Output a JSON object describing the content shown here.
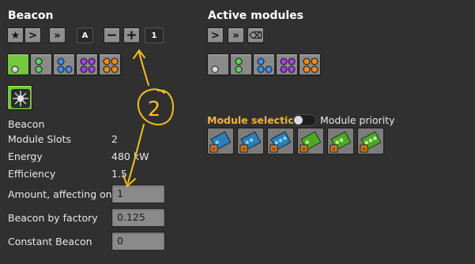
{
  "left": {
    "title": "Beacon",
    "toolbar": [
      {
        "name": "star-icon",
        "glyph": "★"
      },
      {
        "name": "next-icon",
        "glyph": ">"
      },
      {
        "name": "fast-forward-icon",
        "glyph": "»"
      }
    ],
    "mode_label": "A",
    "minus_glyph": "−",
    "plus_glyph": "+",
    "count": "1",
    "beacon_name": "Beacon",
    "stats": [
      {
        "label": "Module Slots",
        "value": "2"
      },
      {
        "label": "Energy",
        "value": "480 kW"
      },
      {
        "label": "Efficiency",
        "value": "1.5"
      }
    ],
    "fields": [
      {
        "label": "Amount, affecting one",
        "value": "1"
      },
      {
        "label": "Beacon by factory",
        "value": "0.125"
      },
      {
        "label": "Constant Beacon",
        "value": "0"
      }
    ]
  },
  "right": {
    "title": "Active modules",
    "toolbar": [
      {
        "name": "next-icon",
        "glyph": ">"
      },
      {
        "name": "fast-forward-icon",
        "glyph": "»"
      },
      {
        "name": "eraser-icon",
        "glyph": "⌫"
      }
    ],
    "module_selection": "Module selection",
    "module_priority": "Module priority"
  },
  "annotation": {
    "text": "2"
  },
  "colors": {
    "accent_orange": "#f2b33f",
    "selected_green": "#73c840",
    "annotation_yellow": "#f6c21a"
  }
}
